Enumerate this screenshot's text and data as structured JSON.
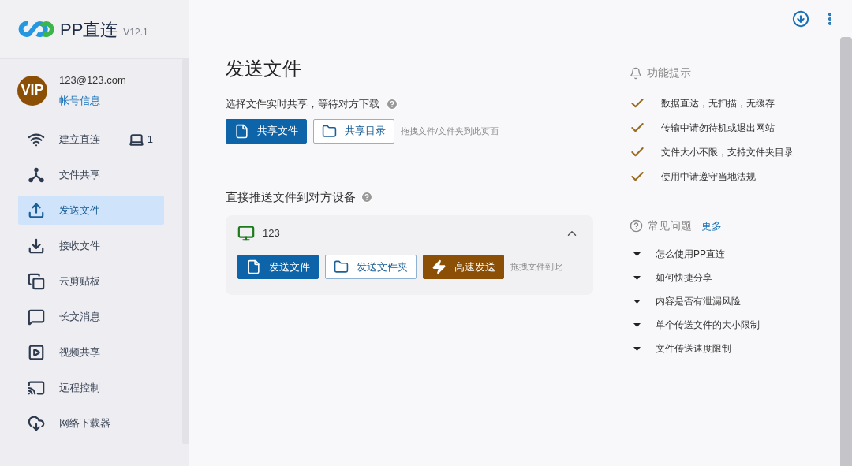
{
  "app": {
    "name": "PP直连",
    "version": "V12.1"
  },
  "account": {
    "badge": "VIP",
    "email": "123@123.com",
    "link": "帐号信息"
  },
  "nav": [
    {
      "kind": "connect",
      "label": "建立直连",
      "selected": false,
      "count": "1"
    },
    {
      "kind": "share",
      "label": "文件共享",
      "selected": false
    },
    {
      "kind": "send",
      "label": "发送文件",
      "selected": true
    },
    {
      "kind": "receive",
      "label": "接收文件",
      "selected": false
    },
    {
      "kind": "clipboard",
      "label": "云剪贴板",
      "selected": false
    },
    {
      "kind": "message",
      "label": "长文消息",
      "selected": false
    },
    {
      "kind": "video",
      "label": "视频共享",
      "selected": false
    },
    {
      "kind": "remote",
      "label": "远程控制",
      "selected": false
    },
    {
      "kind": "download",
      "label": "网络下载器",
      "selected": false
    }
  ],
  "page": {
    "title": "发送文件",
    "share": {
      "label": "选择文件实时共享，等待对方下载",
      "buttons": [
        {
          "kind": "primary",
          "label": "共享文件"
        },
        {
          "kind": "outline",
          "label": "共享目录"
        }
      ],
      "hint": "拖拽文件/文件夹到此页面"
    },
    "push": {
      "label": "直接推送文件到对方设备",
      "device": {
        "name": "123",
        "expanded": true,
        "buttons": [
          {
            "kind": "primary",
            "label": "发送文件"
          },
          {
            "kind": "outline",
            "label": "发送文件夹"
          },
          {
            "kind": "accent",
            "label": "高速发送"
          }
        ],
        "hint": "拖拽文件到此"
      }
    }
  },
  "tips": {
    "title": "功能提示",
    "items": [
      "数据直达，无扫描，无缓存",
      "传输中请勿待机或退出网站",
      "文件大小不限，支持文件夹目录",
      "使用中请遵守当地法规"
    ]
  },
  "faq": {
    "title": "常见问题",
    "more": "更多",
    "items": [
      "怎么使用PP直连",
      "如何快捷分享",
      "内容是否有泄漏风险",
      "单个传送文件的大小限制",
      "文件传送速度限制"
    ]
  }
}
